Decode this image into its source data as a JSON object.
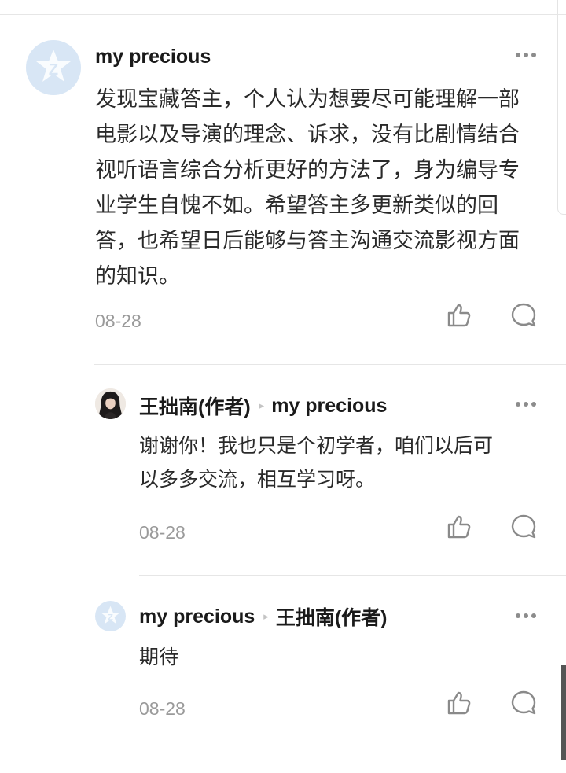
{
  "comments": [
    {
      "author": "my precious",
      "text_lines": [
        "发现宝藏答主，个人认为想要尽可能理解一部",
        "电影以及导演的理念、诉求，没有比剧情结合",
        "视听语言综合分析更好的方法了，身为编导专",
        "业学生自愧不如。希望答主多更新类似的回",
        "答，也希望日后能够与答主沟通交流影视方面",
        "的知识。"
      ],
      "date": "08-28"
    },
    {
      "author": "王拙南(作者)",
      "reply_to": "my precious",
      "text_lines": [
        "谢谢你！我也只是个初学者，咱们以后可",
        "以多多交流，相互学习呀。"
      ],
      "date": "08-28"
    },
    {
      "author": "my precious",
      "reply_to": "王拙南(作者)",
      "text_lines": [
        "期待"
      ],
      "date": "08-28"
    }
  ],
  "icons": {
    "like": "thumbs-up-icon",
    "reply": "comment-bubble-icon",
    "more": "more-dots-icon",
    "arrow": "▸"
  },
  "colors": {
    "avatar_default": "#d8e6f5",
    "text": "#2a2a2a",
    "muted": "#9a9a9a",
    "divider": "#e6e6e6"
  }
}
